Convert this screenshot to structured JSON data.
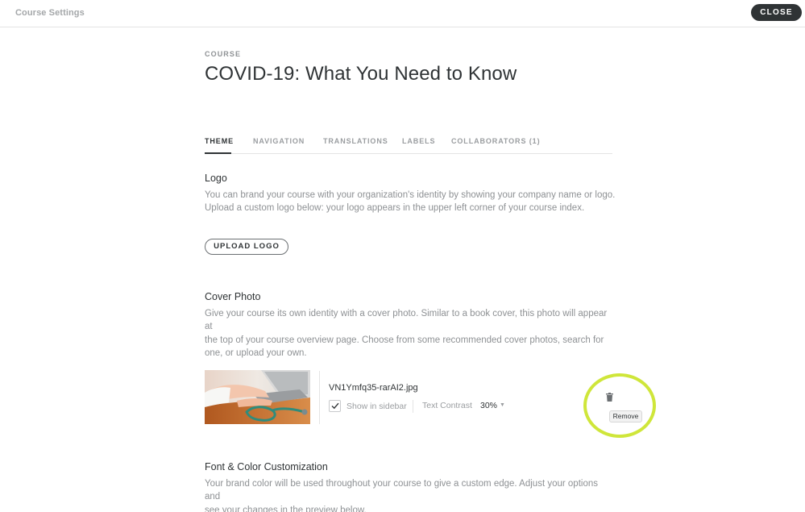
{
  "topbar": {
    "title": "Course Settings",
    "close_label": "CLOSE"
  },
  "course": {
    "label": "COURSE",
    "title": "COVID-19: What You Need to Know"
  },
  "tabs": [
    {
      "label": "THEME",
      "active": true
    },
    {
      "label": "NAVIGATION",
      "active": false
    },
    {
      "label": "TRANSLATIONS",
      "active": false
    },
    {
      "label": "LABELS",
      "active": false
    },
    {
      "label": "COLLABORATORS (1)",
      "active": false
    }
  ],
  "logo": {
    "title": "Logo",
    "desc_line1": "You can brand your course with your organization's identity by showing your company name or logo.",
    "desc_line2": "Upload a custom logo below: your logo appears in the upper left corner of your course index.",
    "upload_label": "UPLOAD LOGO"
  },
  "cover": {
    "title": "Cover Photo",
    "desc_line1": "Give your course its own identity with a cover photo. Similar to a book cover, this photo will appear at",
    "desc_line2": "the top of your course overview page. Choose from some recommended cover photos, search for",
    "desc_line3": "one, or upload your own.",
    "file_name": "VN1Ymfq35-rarAI2.jpg",
    "show_in_sidebar_label": "Show in sidebar",
    "show_in_sidebar_checked": true,
    "text_contrast_label": "Text Contrast",
    "text_contrast_value": "30%",
    "remove_tooltip": "Remove",
    "highlight_color": "#cfe63a"
  },
  "font_color": {
    "title": "Font & Color Customization",
    "desc_line1": "Your brand color will be used throughout your course to give a custom edge. Adjust your options and",
    "desc_line2": "see your changes in the preview below."
  },
  "icons": {
    "checkbox": "checkmark-icon",
    "remove": "trash-icon",
    "dropdown": "caret-down-icon"
  }
}
